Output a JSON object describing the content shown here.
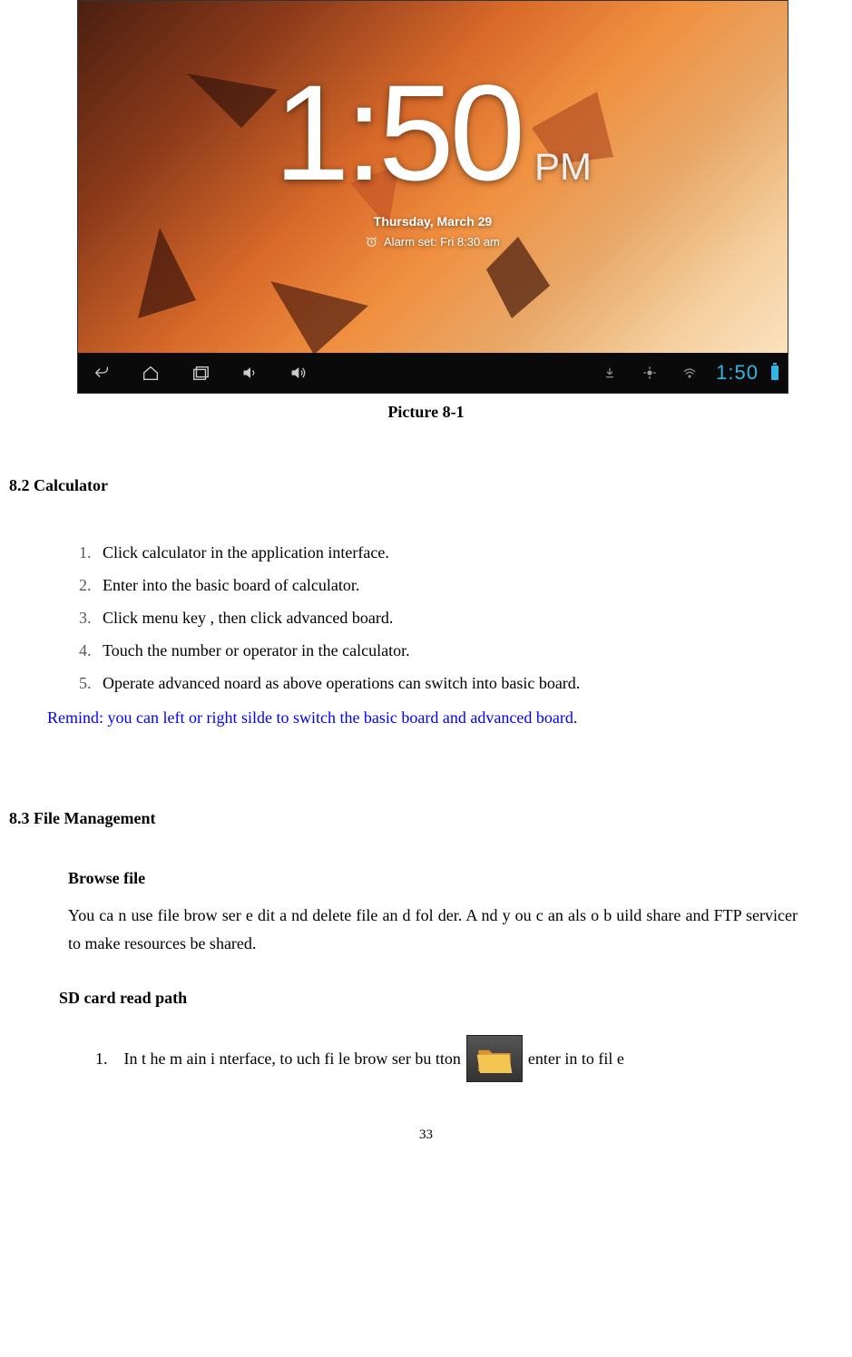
{
  "screenshot": {
    "clock_time": "1:50",
    "clock_ampm": "PM",
    "date": "Thursday, March 29",
    "alarm": "Alarm set: Fri 8:30 am",
    "nav_clock": "1:50"
  },
  "caption": "Picture 8-1",
  "section_8_2": {
    "heading": "8.2 Calculator",
    "items": [
      "Click calculator in the application interface.",
      "Enter into the basic board of calculator.",
      "Click menu key , then click advanced board.",
      "Touch the number or operator in the calculator.",
      "Operate advanced noard as above operations can switch into basic board."
    ],
    "remind": "Remind: you can left or right silde to switch the basic board and advanced board."
  },
  "section_8_3": {
    "heading": "8.3 File Management",
    "browse_heading": "Browse file",
    "browse_text": "You ca n use  file brow ser e dit a nd  delete file an d fol der. A nd y ou c an als o b uild share and FTP servicer to make resources be shared.",
    "sd_heading": "SD card read path",
    "sd_item_num": "1.",
    "sd_item_pre": "In t he m ain i nterface, to uch fi le brow ser bu tton ",
    "sd_item_post": " enter in to fil e"
  },
  "page_number": "33"
}
